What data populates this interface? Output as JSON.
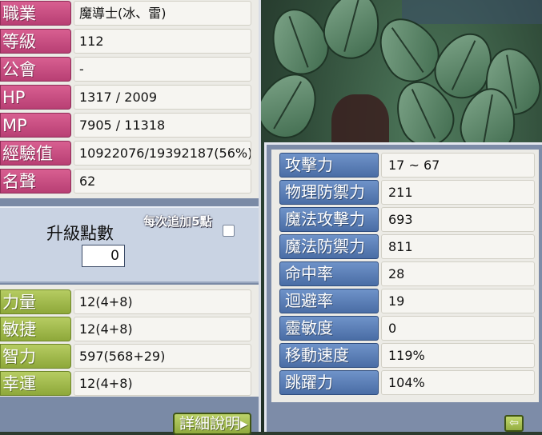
{
  "basic_info": [
    {
      "label": "職業",
      "value": "魔導士(冰、雷)"
    },
    {
      "label": "等級",
      "value": "112"
    },
    {
      "label": "公會",
      "value": "-"
    },
    {
      "label": "HP",
      "value": "1317 / 2009"
    },
    {
      "label": "MP",
      "value": "7905 / 11318"
    },
    {
      "label": "經驗值",
      "value": "10922076/19392187(56%)"
    },
    {
      "label": "名聲",
      "value": "62"
    }
  ],
  "ability_points": {
    "label": "升級點數",
    "value": "0",
    "auto_assign_label": "每次追加5點"
  },
  "main_stats": [
    {
      "label": "力量",
      "value": "12(4+8)"
    },
    {
      "label": "敏捷",
      "value": "12(4+8)"
    },
    {
      "label": "智力",
      "value": "597(568+29)"
    },
    {
      "label": "幸運",
      "value": "12(4+8)"
    }
  ],
  "detail_button": {
    "label": "詳細說明",
    "arrow": "▸"
  },
  "detail_stats": [
    {
      "label": "攻擊力",
      "value": "17 ~ 67"
    },
    {
      "label": "物理防禦力",
      "value": "211"
    },
    {
      "label": "魔法攻擊力",
      "value": "693"
    },
    {
      "label": "魔法防禦力",
      "value": "811"
    },
    {
      "label": "命中率",
      "value": "28"
    },
    {
      "label": "迴避率",
      "value": "19"
    },
    {
      "label": "靈敏度",
      "value": "0"
    },
    {
      "label": "移動速度",
      "value": "119%"
    },
    {
      "label": "跳躍力",
      "value": "104%"
    }
  ],
  "back_button": {
    "icon": "back-arrow-icon",
    "glyph": "⇦"
  },
  "colors": {
    "label_pink": "#c84c82",
    "label_green": "#a2bb4c",
    "label_blue": "#5a7fb8",
    "panel_bg": "#ecebe6",
    "window_frame": "#7a8aa6"
  }
}
